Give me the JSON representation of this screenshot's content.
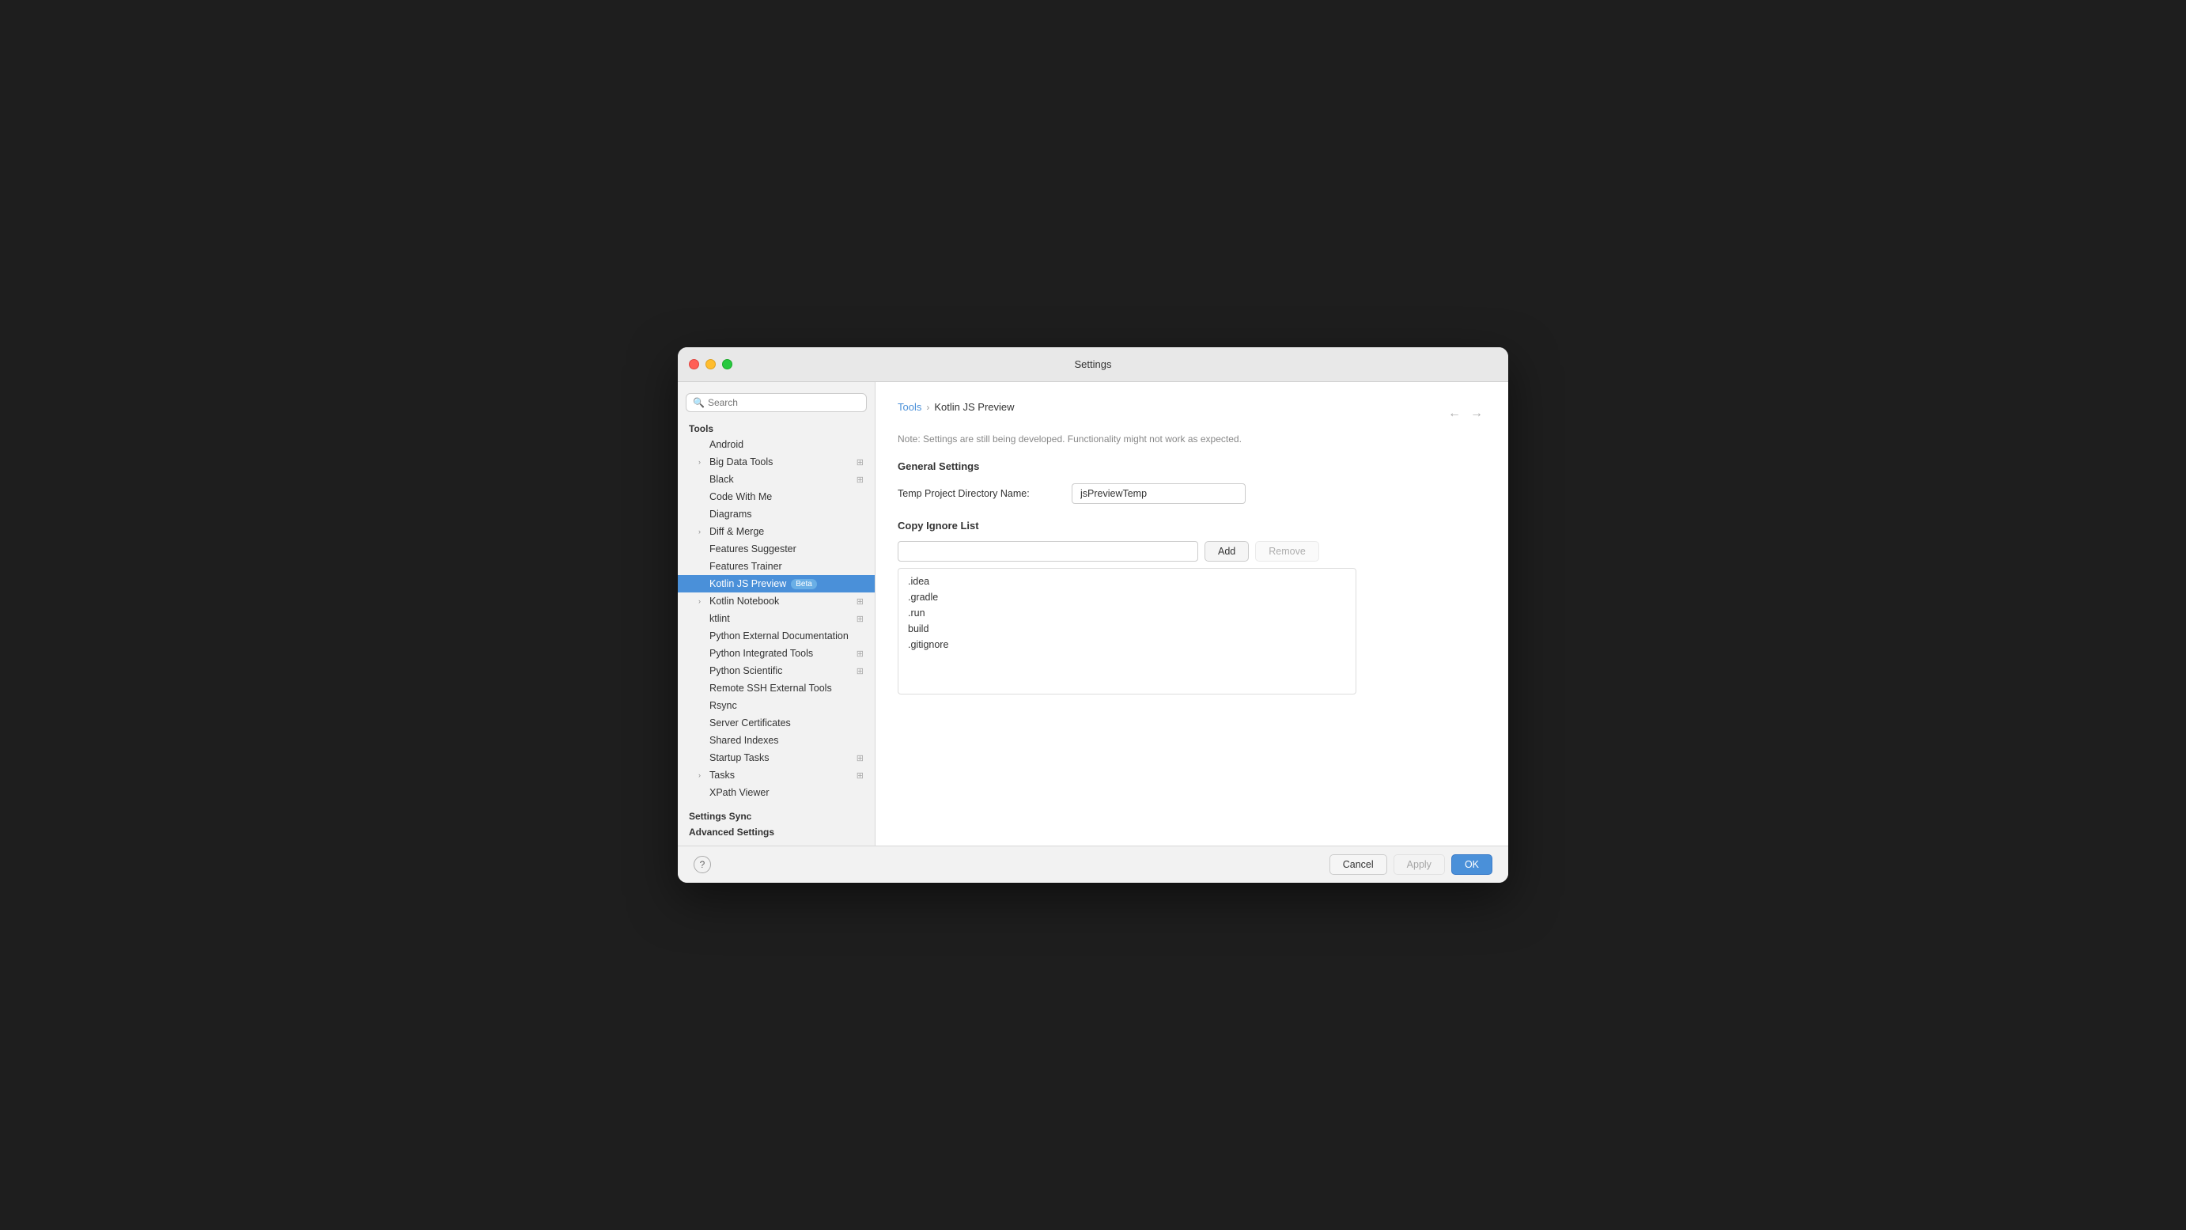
{
  "window": {
    "title": "Settings"
  },
  "sidebar": {
    "search_placeholder": "Search",
    "tools_label": "Tools",
    "items": [
      {
        "id": "android",
        "label": "Android",
        "indent": 1,
        "chevron": false,
        "sync": false
      },
      {
        "id": "big-data-tools",
        "label": "Big Data Tools",
        "indent": 1,
        "chevron": true,
        "sync": true
      },
      {
        "id": "black",
        "label": "Black",
        "indent": 1,
        "chevron": false,
        "sync": true
      },
      {
        "id": "code-with-me",
        "label": "Code With Me",
        "indent": 1,
        "chevron": false,
        "sync": false
      },
      {
        "id": "diagrams",
        "label": "Diagrams",
        "indent": 1,
        "chevron": false,
        "sync": false
      },
      {
        "id": "diff-merge",
        "label": "Diff & Merge",
        "indent": 1,
        "chevron": true,
        "sync": false
      },
      {
        "id": "features-suggester",
        "label": "Features Suggester",
        "indent": 1,
        "chevron": false,
        "sync": false
      },
      {
        "id": "features-trainer",
        "label": "Features Trainer",
        "indent": 1,
        "chevron": false,
        "sync": false
      },
      {
        "id": "kotlin-js-preview",
        "label": "Kotlin JS Preview",
        "indent": 1,
        "chevron": false,
        "sync": false,
        "badge": "Beta",
        "active": true
      },
      {
        "id": "kotlin-notebook",
        "label": "Kotlin Notebook",
        "indent": 1,
        "chevron": true,
        "sync": true
      },
      {
        "id": "ktlint",
        "label": "ktlint",
        "indent": 1,
        "chevron": false,
        "sync": true
      },
      {
        "id": "python-ext-doc",
        "label": "Python External Documentation",
        "indent": 1,
        "chevron": false,
        "sync": false
      },
      {
        "id": "python-integrated-tools",
        "label": "Python Integrated Tools",
        "indent": 1,
        "chevron": false,
        "sync": true
      },
      {
        "id": "python-scientific",
        "label": "Python Scientific",
        "indent": 1,
        "chevron": false,
        "sync": true
      },
      {
        "id": "remote-ssh",
        "label": "Remote SSH External Tools",
        "indent": 1,
        "chevron": false,
        "sync": false
      },
      {
        "id": "rsync",
        "label": "Rsync",
        "indent": 1,
        "chevron": false,
        "sync": false
      },
      {
        "id": "server-certificates",
        "label": "Server Certificates",
        "indent": 1,
        "chevron": false,
        "sync": false
      },
      {
        "id": "shared-indexes",
        "label": "Shared Indexes",
        "indent": 1,
        "chevron": false,
        "sync": false
      },
      {
        "id": "startup-tasks",
        "label": "Startup Tasks",
        "indent": 1,
        "chevron": false,
        "sync": true
      },
      {
        "id": "tasks",
        "label": "Tasks",
        "indent": 1,
        "chevron": true,
        "sync": true
      },
      {
        "id": "xpath-viewer",
        "label": "XPath Viewer",
        "indent": 1,
        "chevron": false,
        "sync": false
      }
    ],
    "settings_sync_label": "Settings Sync",
    "advanced_settings_label": "Advanced Settings"
  },
  "breadcrumb": {
    "parent": "Tools",
    "separator": "›",
    "current": "Kotlin JS Preview"
  },
  "content": {
    "note": "Note: Settings are still being developed. Functionality might not work as expected.",
    "general_settings_title": "General Settings",
    "temp_dir_label": "Temp Project Directory Name:",
    "temp_dir_value": "jsPreviewTemp",
    "copy_ignore_title": "Copy Ignore List",
    "copy_ignore_input_value": "",
    "add_button": "Add",
    "remove_button": "Remove",
    "ignore_items": [
      ".idea",
      ".gradle",
      ".run",
      "build",
      ".gitignore"
    ]
  },
  "footer": {
    "help_label": "?",
    "cancel_label": "Cancel",
    "apply_label": "Apply",
    "ok_label": "OK"
  }
}
